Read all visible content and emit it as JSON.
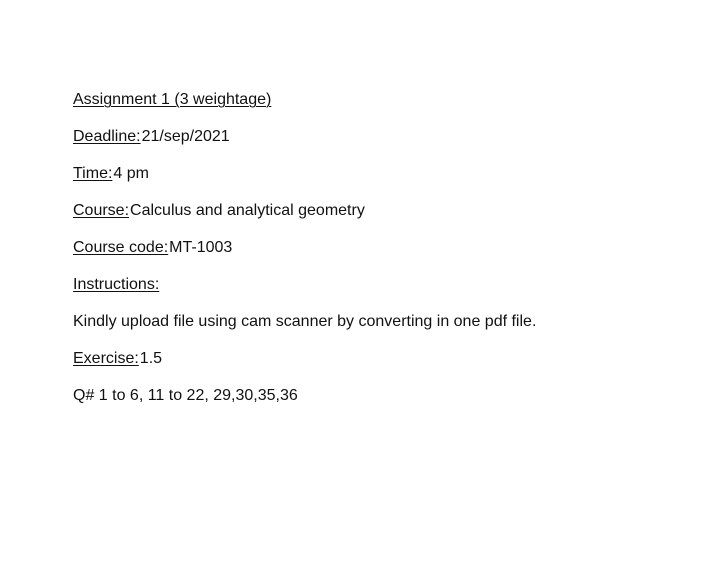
{
  "document": {
    "title": "Assignment 1 (3 weightage)",
    "deadline_label": "Deadline:",
    "deadline_value": "21/sep/2021",
    "time_label": "Time:",
    "time_value": "4 pm",
    "course_label": "Course:",
    "course_value": "Calculus and analytical geometry",
    "course_code_label": "Course code:",
    "course_code_value": "MT-1003",
    "instructions_label": "Instructions:",
    "instructions_text": "Kindly upload file using cam scanner by converting in one pdf file.",
    "exercise_label": "Exercise:",
    "exercise_value": "1.5",
    "questions_text": "Q# 1 to 6, 11 to 22, 29,30,35,36"
  }
}
